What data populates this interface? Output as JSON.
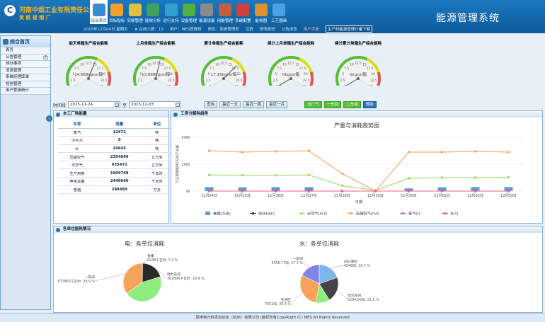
{
  "header": {
    "logo_letter": "C",
    "company": "河南中烟工业有限责任公司",
    "plant": "黄 鹤 楼 烟 厂",
    "app_title": "能源管理系统",
    "modules": [
      {
        "label": "综合首页",
        "active": true,
        "color": "#3a8bd0"
      },
      {
        "label": "目标指标",
        "color": "#f0a030"
      },
      {
        "label": "实绩管理",
        "color": "#e0c040"
      },
      {
        "label": "能效分析",
        "color": "#40a060"
      },
      {
        "label": "运行支持",
        "color": "#30a0d0"
      },
      {
        "label": "设备管理",
        "color": "#50b040"
      },
      {
        "label": "能源设备",
        "color": "#8a8a8a"
      },
      {
        "label": "用能管理",
        "color": "#c06040"
      },
      {
        "label": "系统配置",
        "color": "#d04040"
      },
      {
        "label": "能效图",
        "color": "#e09030"
      },
      {
        "label": "工艺图画",
        "color": "#4aa0e0"
      }
    ],
    "info": [
      "2015年12月04日 星期五",
      "★ 在线人数：13",
      "用户：MES管理员",
      "角色：系统管理员",
      "注销",
      "修改密码",
      "公告浏览",
      "用户手册"
    ],
    "info_box": "生产科能源管理计量下载"
  },
  "sidebar": {
    "title": "综合首页",
    "items": [
      {
        "label": "首页"
      },
      {
        "label": "公告管理",
        "expandable": true
      },
      {
        "label": "待办事项"
      },
      {
        "label": "消息管理"
      },
      {
        "label": "系统经理库单"
      },
      {
        "label": "短信管理"
      },
      {
        "label": "用户登录统计"
      }
    ]
  },
  "gauges": [
    {
      "title": "前天单箱生产综合能耗",
      "value_text": "14.688kgce/箱",
      "value": 14.688
    },
    {
      "title": "上月单箱生产综合能耗",
      "value_text": "13.888kgce/箱",
      "value": 13.888
    },
    {
      "title": "累计单箱生产综合能耗",
      "value_text": "17.16kgce/箱",
      "value": 17.16
    },
    {
      "title": "续计上月单箱生产综合能耗",
      "value_text": "0kgce/箱",
      "value": 0
    },
    {
      "title": "续计累计单箱生产综合能耗",
      "value_text": "0kgce/箱",
      "value": 0
    }
  ],
  "gauge_ticks": [
    "0",
    "2.5",
    "5",
    "7.5",
    "10",
    "12.5",
    "15",
    "17.5",
    "20",
    "22.5",
    "25"
  ],
  "filters": {
    "period_label": "时间段",
    "start": "2015-11-24",
    "to": "至",
    "end": "2015-12-03",
    "buttons": [
      "查询",
      "最近一天",
      "最近一周",
      "最近一月"
    ],
    "green_buttons": [
      "日广气",
      "一车间",
      "二车间"
    ],
    "blue_button": "预助"
  },
  "consumption": {
    "title": "本工厂耗能量",
    "columns": [
      "名称",
      "用量",
      "单位"
    ],
    "rows": [
      [
        "蒸气",
        "11972",
        "吨"
      ],
      [
        "冷水水",
        "0",
        "吨"
      ],
      [
        "水",
        "34645",
        "吨"
      ],
      [
        "压缩空气",
        "2354099",
        "立方米"
      ],
      [
        "天然气",
        "935472",
        "立方米"
      ],
      [
        "生产用电",
        "1909768",
        "千瓦时"
      ],
      [
        "声电总量",
        "2440960",
        "千瓦时"
      ],
      [
        "卷烟",
        "288499",
        "万支"
      ]
    ]
  },
  "trend": {
    "title": "工序分解耗趋势"
  },
  "units": {
    "title": "各单位能耗情况"
  },
  "footer": "思维特万科思自动化（杭州）有限公司 |版权所有CopyRight (C) MES All Rights Reserved",
  "chart_data": [
    {
      "type": "line",
      "title": "产量与消耗趋势图",
      "xlabel": "日期",
      "ylabel": "万支卷烟能耗/天生产总量",
      "y_ticks": [
        "400k",
        "200k",
        "0k"
      ],
      "ylim": [
        0,
        400000
      ],
      "categories": [
        "11月24日",
        "11月25日",
        "11月26日",
        "11月27日",
        "11月28日",
        "11月29日",
        "11月30日",
        "12月01日",
        "12月02日",
        "12月03日"
      ],
      "series": [
        {
          "name": "卷烟(万支)",
          "kind": "bar",
          "color": "#5b9bd5",
          "values": [
            30000,
            28000,
            29000,
            29000,
            0,
            0,
            20000,
            28000,
            30000,
            30000
          ]
        },
        {
          "name": "电(Kkwh)",
          "color": "#333333",
          "values": [
            0,
            0,
            0,
            0,
            0,
            0,
            0,
            0,
            0,
            0
          ]
        },
        {
          "name": "天然气(m3)",
          "color": "#9bdb66",
          "values": [
            120000,
            118000,
            117000,
            120000,
            40000,
            5000,
            95000,
            100000,
            100000,
            103000
          ]
        },
        {
          "name": "压缩空气(m3)",
          "color": "#f7a35c",
          "values": [
            300000,
            290000,
            295000,
            300000,
            130000,
            0,
            290000,
            290000,
            295000,
            290000
          ]
        },
        {
          "name": "蒸气(t)",
          "color": "#8085e9",
          "values": [
            0,
            0,
            0,
            0,
            0,
            0,
            0,
            0,
            0,
            0
          ]
        },
        {
          "name": "水(t)",
          "color": "#f15c80",
          "values": [
            0,
            0,
            0,
            0,
            0,
            0,
            0,
            0,
            0,
            0
          ]
        }
      ]
    },
    {
      "type": "pie",
      "title": "电：各单位消耗",
      "slices": [
        {
          "label": "食库",
          "value_text": "6248千瓦时: 0.3 %",
          "value": 0.3,
          "color": "#434348"
        },
        {
          "label": "动力车间",
          "value_text": "382806千瓦时: 19.9 %",
          "value": 19.9,
          "color": "#2b2b2b"
        },
        {
          "label": "",
          "value_text": "",
          "value": 45.0,
          "color": "#90ed7d"
        },
        {
          "label": "一车间",
          "value_text": "671860千瓦时: 34.9 %",
          "value": 34.9,
          "color": "#f7a35c"
        }
      ]
    },
    {
      "type": "pie",
      "title": "水：各单位消耗",
      "slices": [
        {
          "label": "办公单位",
          "value_text": "4848吨: 19.7 %",
          "value": 19.7,
          "color": "#7cb5ec"
        },
        {
          "label": "动力车间",
          "value_text": "5294.50吨: 21.5 %",
          "value": 21.5,
          "color": "#434348"
        },
        {
          "label": "",
          "value_text": "",
          "value": 11.6,
          "color": "#90ed7d"
        },
        {
          "label": "生活区",
          "value_text": "7351吨: 29.6 %",
          "value": 29.6,
          "color": "#f7a35c"
        },
        {
          "label": "一车间",
          "value_text": "4356.77吨: 17.7 %",
          "value": 17.7,
          "color": "#8085e9"
        }
      ]
    }
  ]
}
